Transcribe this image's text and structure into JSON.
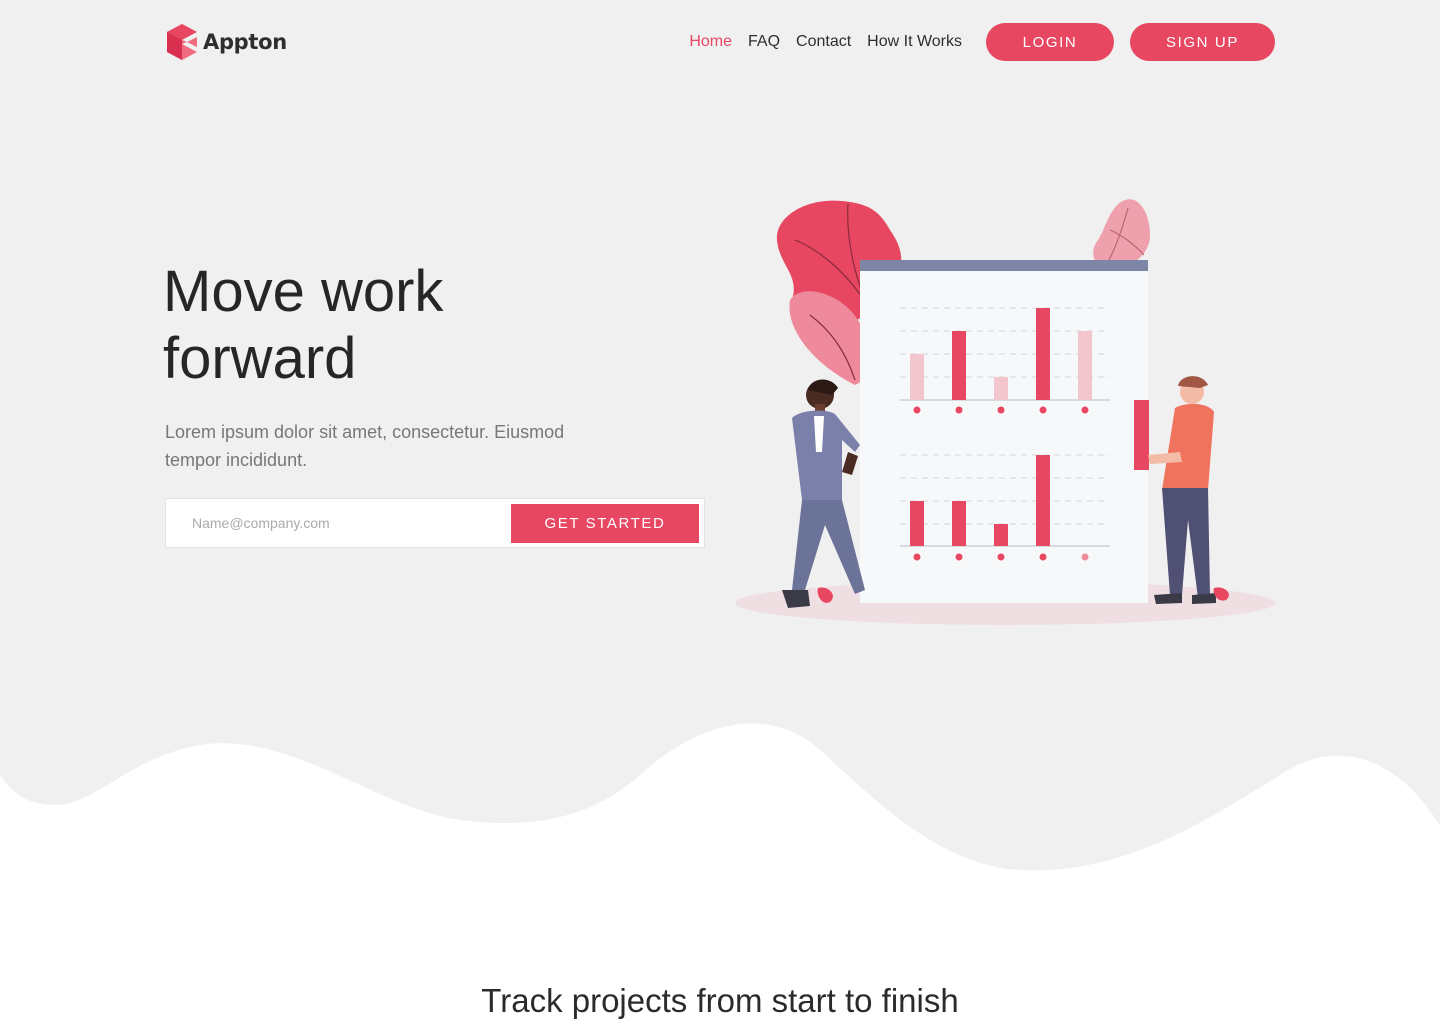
{
  "brand": {
    "name": "Appton",
    "accent": "#e84762",
    "hero_bg": "#f0f0f0"
  },
  "nav": {
    "links": [
      "Home",
      "FAQ",
      "Contact",
      "How It Works"
    ],
    "active": "Home",
    "login_label": "LOGIN",
    "signup_label": "SIGN UP"
  },
  "hero": {
    "title_line1": "Move work",
    "title_line2": "forward",
    "subtitle": "Lorem ipsum dolor sit amet, consectetur. Eiusmod tempor incididunt.",
    "email_placeholder": "Name@company.com",
    "email_value": "",
    "cta_label": "GET STARTED"
  },
  "illustration": {
    "subject": "two people presenting a board with bar charts",
    "icon": "analytics-board-illustration"
  },
  "features": {
    "title": "Track projects from start to finish"
  }
}
